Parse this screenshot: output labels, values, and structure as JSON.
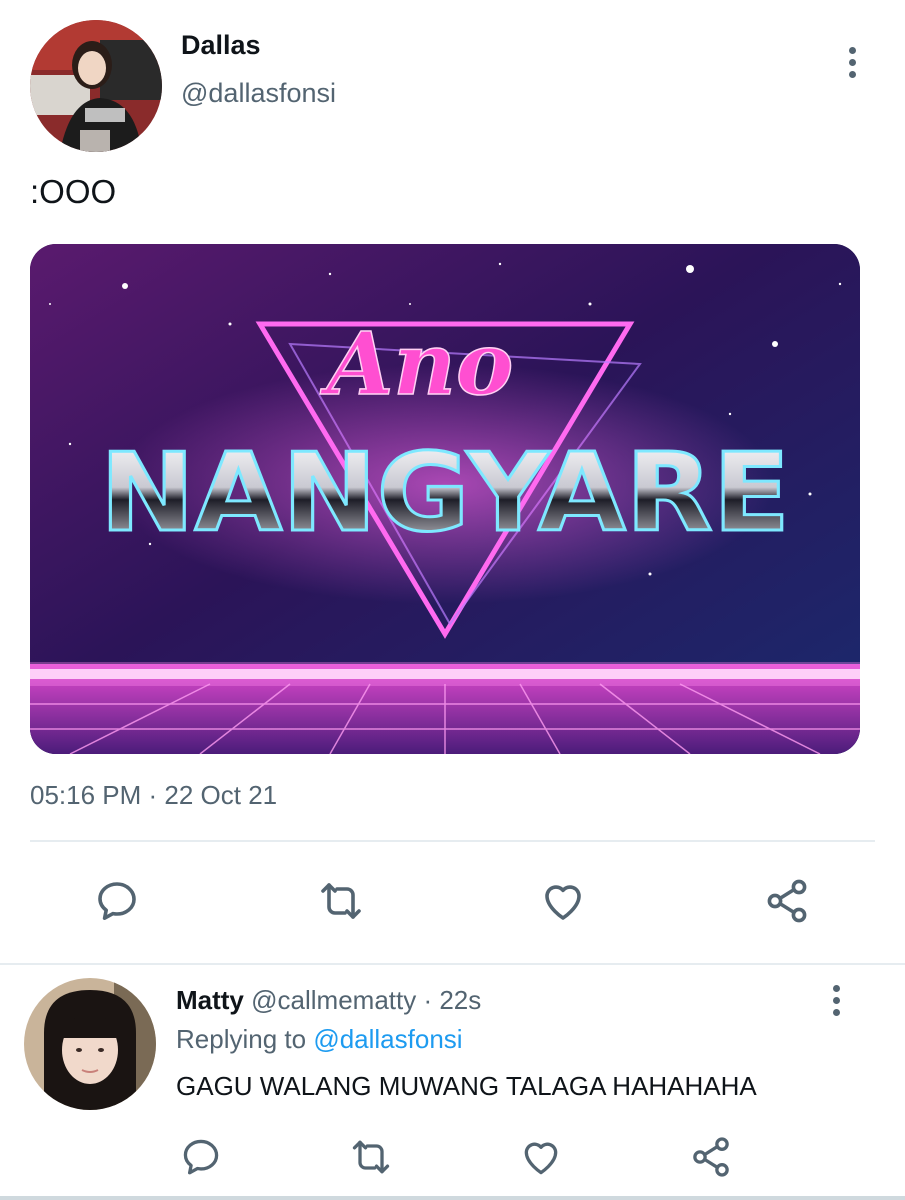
{
  "tweet": {
    "author_name": "Dallas",
    "author_handle": "@dallasfonsi",
    "text": ":OOO",
    "media": {
      "top_text": "Ano",
      "main_text": "NANGYARE"
    },
    "timestamp": "05:16 PM · 22 Oct 21",
    "actions": [
      {
        "name": "reply",
        "icon": "comment-icon"
      },
      {
        "name": "retweet",
        "icon": "retweet-icon"
      },
      {
        "name": "like",
        "icon": "heart-icon"
      },
      {
        "name": "share",
        "icon": "share-icon"
      }
    ]
  },
  "reply": {
    "author_name": "Matty",
    "author_handle": "@callmematty",
    "separator": " · ",
    "time": "22s",
    "replying_to_label": "Replying to ",
    "replying_to_handle": "@dallasfonsi",
    "text": "GAGU WALANG MUWANG TALAGA HAHAHAHA"
  },
  "colors": {
    "text_primary": "#0f1419",
    "text_secondary": "#536471",
    "link": "#1d9bf0",
    "divider": "#e6ecf0"
  }
}
